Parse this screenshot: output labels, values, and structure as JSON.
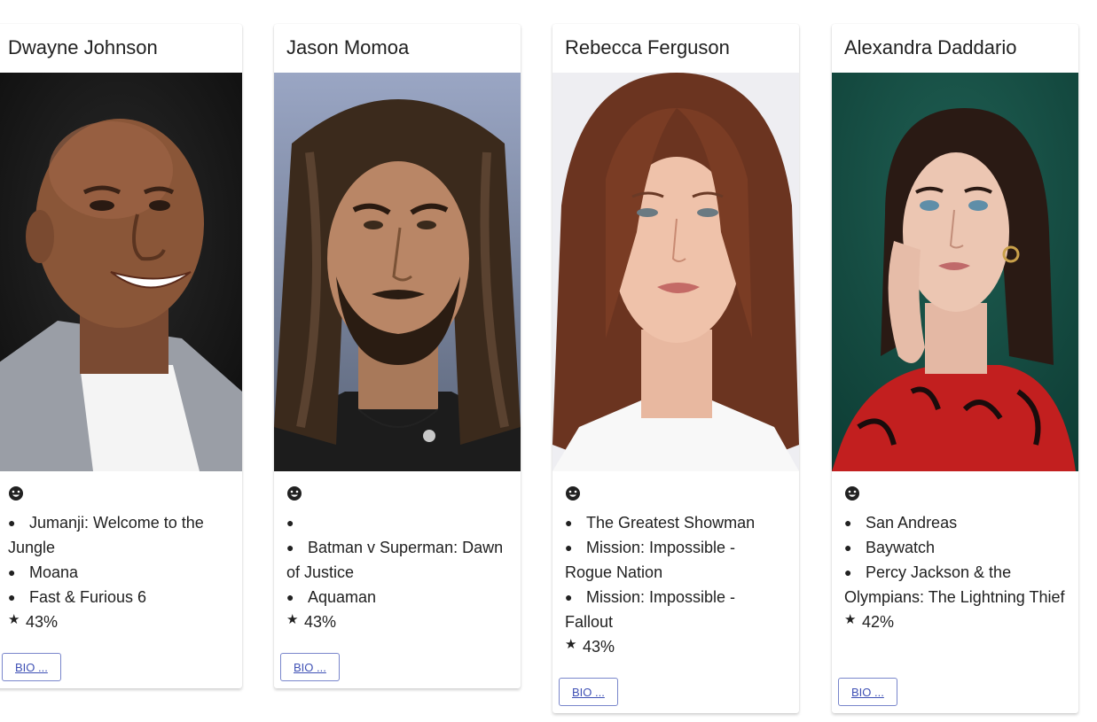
{
  "cards": [
    {
      "name": "Dwayne Johnson",
      "photo_alt": "portrait",
      "status_icon": "smile-icon",
      "films": [
        "Jumanji: Welcome to the Jungle",
        "Moana",
        "Fast & Furious 6"
      ],
      "rating_icon": "star-icon",
      "rating": "43%",
      "bio_label": "BIO ..."
    },
    {
      "name": "Jason Momoa",
      "photo_alt": "portrait",
      "status_icon": "smile-icon",
      "films": [
        "",
        "Batman v Superman: Dawn of Justice",
        "Aquaman"
      ],
      "rating_icon": "star-icon",
      "rating": "43%",
      "bio_label": "BIO ..."
    },
    {
      "name": "Rebecca Ferguson",
      "photo_alt": "portrait",
      "status_icon": "smile-icon",
      "films": [
        "The Greatest Showman",
        "Mission: Impossible - Rogue Nation",
        "Mission: Impossible - Fallout"
      ],
      "rating_icon": "star-icon",
      "rating": "43%",
      "bio_label": "BIO ..."
    },
    {
      "name": "Alexandra Daddario",
      "photo_alt": "portrait",
      "status_icon": "smile-icon",
      "films": [
        "San Andreas",
        "Baywatch",
        "Percy Jackson & the Olympians: The Lightning Thief"
      ],
      "rating_icon": "star-icon",
      "rating": "42%",
      "bio_label": "BIO ..."
    }
  ],
  "colors": {
    "button_border": "#7986cb",
    "button_text": "#3f51b5"
  }
}
